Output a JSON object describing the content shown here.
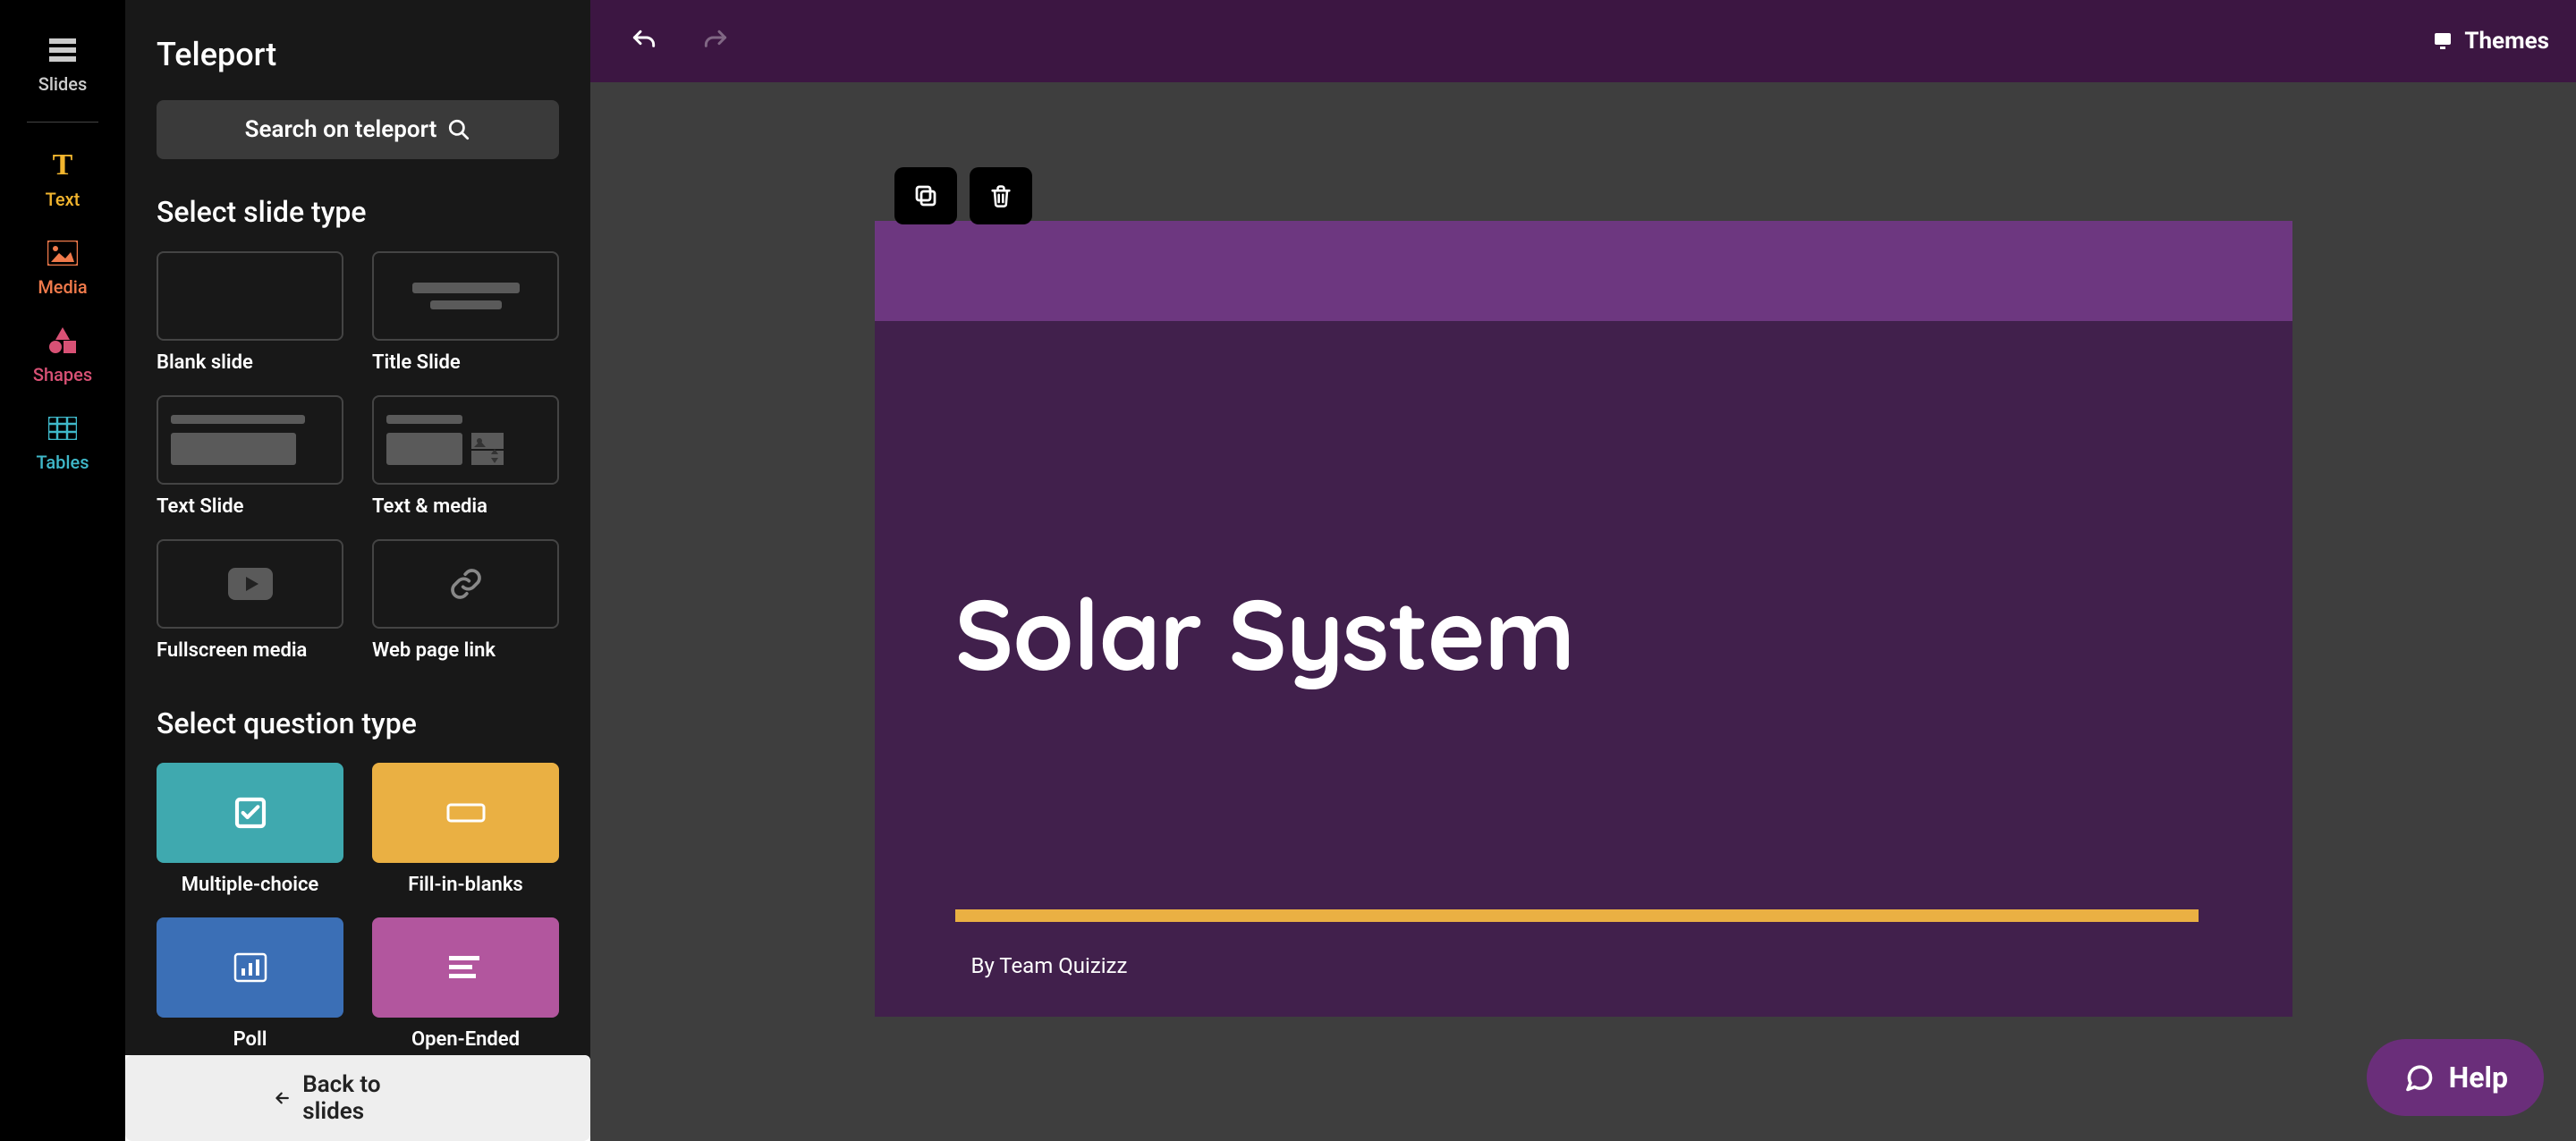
{
  "rail": {
    "slides": "Slides",
    "text": "Text",
    "media": "Media",
    "shapes": "Shapes",
    "tables": "Tables"
  },
  "panel": {
    "title": "Teleport",
    "search_label": "Search on teleport",
    "slide_section": "Select slide type",
    "slide_types": {
      "blank": "Blank slide",
      "title": "Title Slide",
      "text": "Text Slide",
      "text_media": "Text & media",
      "fullscreen_media": "Fullscreen media",
      "webpage": "Web page link"
    },
    "question_section": "Select question type",
    "question_types": {
      "mc": "Multiple-choice",
      "fib": "Fill-in-blanks",
      "poll": "Poll",
      "open": "Open-Ended"
    },
    "back": "Back to slides"
  },
  "topbar": {
    "themes": "Themes"
  },
  "slide": {
    "title": "Solar System",
    "byline": "By Team Quizizz"
  },
  "help": "Help",
  "colors": {
    "text": "#f2b52e",
    "media": "#f07a4b",
    "shapes": "#d85175",
    "tables": "#3fb8c9",
    "mc_bg": "#3fa9af",
    "fib_bg": "#eab043",
    "poll_bg": "#3b6fb6",
    "open_bg": "#b2569e"
  }
}
